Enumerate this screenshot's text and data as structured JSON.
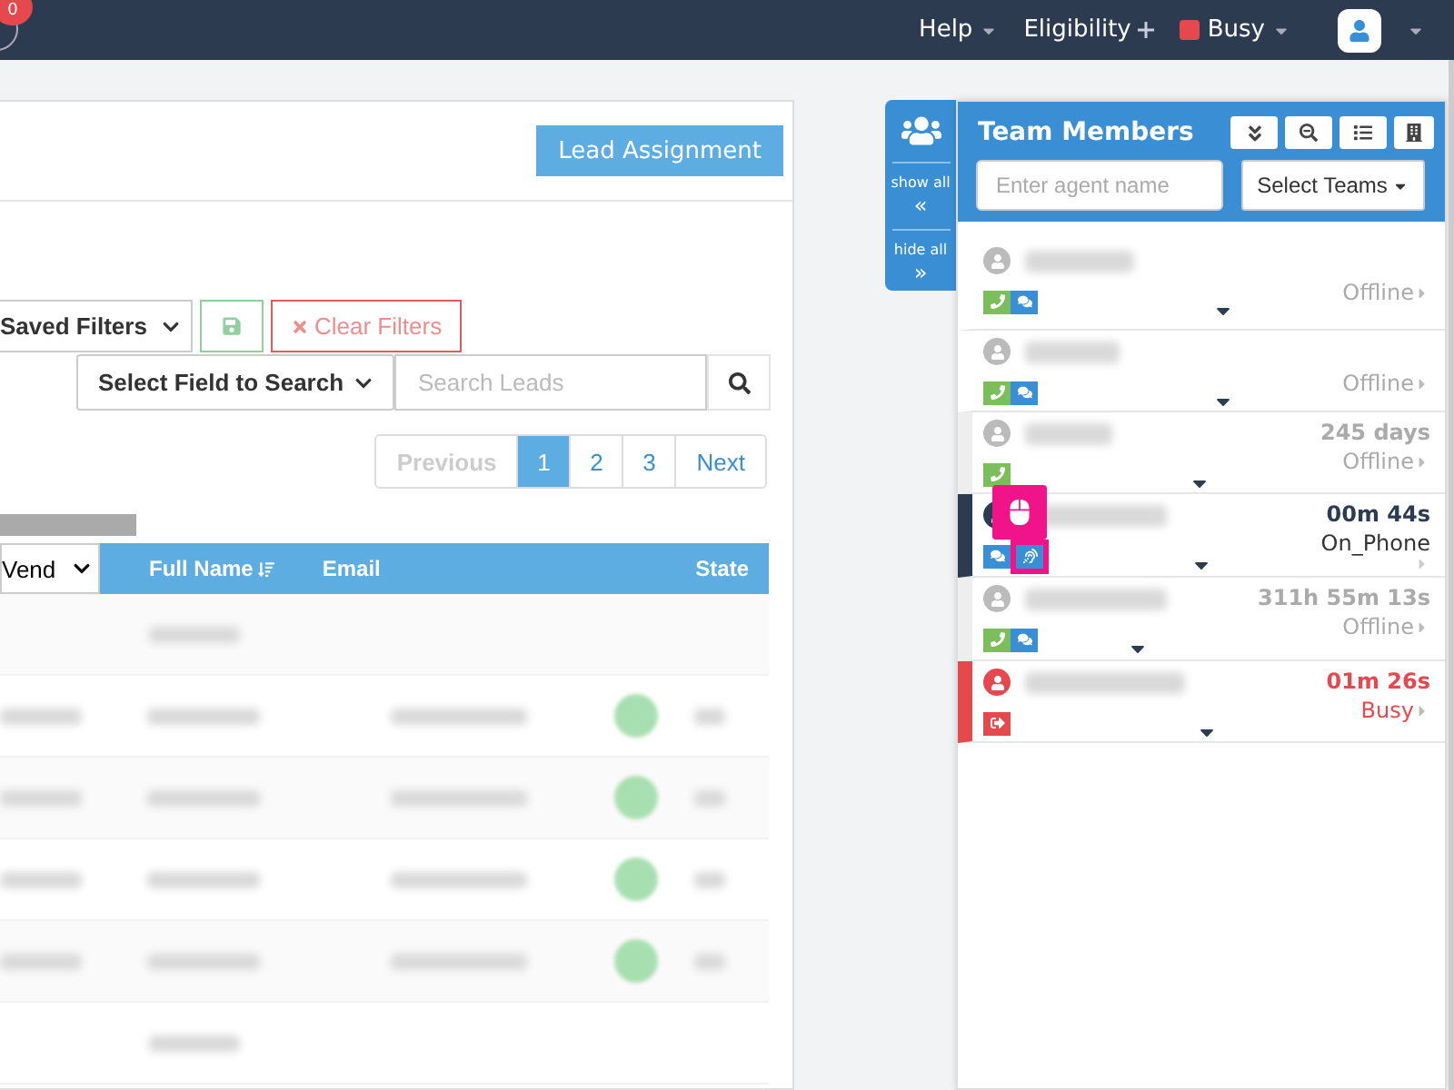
{
  "top_bar": {
    "badge": "0",
    "menus": [
      {
        "label": "Help",
        "kind": "dropdown"
      },
      {
        "label": "Eligibility",
        "kind": "plus"
      },
      {
        "label": "Busy",
        "kind": "status",
        "color": "#e5484d"
      }
    ]
  },
  "leads": {
    "assign_button": "Lead Assignment",
    "saved_filters": "Saved Filters",
    "clear_filters": "Clear Filters",
    "field_select": "Select Field to Search",
    "search": {
      "placeholder": "Search Leads"
    },
    "pagination": [
      {
        "label": "Previous",
        "kind": "prev",
        "disabled": true,
        "selected": false
      },
      {
        "label": "1",
        "kind": "page",
        "disabled": false,
        "selected": true
      },
      {
        "label": "2",
        "kind": "page",
        "disabled": false,
        "selected": false
      },
      {
        "label": "3",
        "kind": "page",
        "disabled": false,
        "selected": false
      },
      {
        "label": "Next",
        "kind": "next",
        "disabled": false,
        "selected": false
      }
    ],
    "table": {
      "column_select": "Vend",
      "columns": [
        {
          "label": "Full Name",
          "sortable": true
        },
        {
          "label": "Email",
          "sortable": false
        },
        {
          "label": "State",
          "sortable": false
        }
      ],
      "rows": [
        {
          "kind": "group"
        },
        {
          "kind": "lead"
        },
        {
          "kind": "lead"
        },
        {
          "kind": "lead"
        },
        {
          "kind": "lead"
        },
        {
          "kind": "group"
        }
      ]
    }
  },
  "side_tab": {
    "show_all": "show all",
    "show_all_arrow": "«",
    "hide_all": "hide all",
    "hide_all_arrow": "»"
  },
  "team": {
    "title": "Team Members",
    "search": {
      "placeholder": "Enter agent name"
    },
    "teams_select": "Select Teams",
    "members": [
      {
        "kind": "offline",
        "icons": [
          {
            "kind": "phone",
            "highlighted": false
          },
          {
            "kind": "chat",
            "highlighted": false
          }
        ],
        "status": "Offline"
      },
      {
        "kind": "offline",
        "icons": [
          {
            "kind": "phone",
            "highlighted": false
          },
          {
            "kind": "chat",
            "highlighted": false
          }
        ],
        "status": "Offline"
      },
      {
        "kind": "offline",
        "icons": [
          {
            "kind": "phone",
            "highlighted": false
          }
        ],
        "time": "245 days",
        "status": "Offline"
      },
      {
        "kind": "on_phone",
        "icons": [
          {
            "kind": "chat",
            "highlighted": false
          },
          {
            "kind": "listen",
            "highlighted": true
          }
        ],
        "time": "00m 44s",
        "status": "On_Phone"
      },
      {
        "kind": "offline",
        "icons": [
          {
            "kind": "phone",
            "highlighted": false
          },
          {
            "kind": "chat",
            "highlighted": false
          }
        ],
        "time": "311h 55m 13s",
        "status": "Offline"
      },
      {
        "kind": "busy",
        "icons": [
          {
            "kind": "logout",
            "highlighted": false
          }
        ],
        "time": "01m 26s",
        "status": "Busy"
      }
    ]
  }
}
